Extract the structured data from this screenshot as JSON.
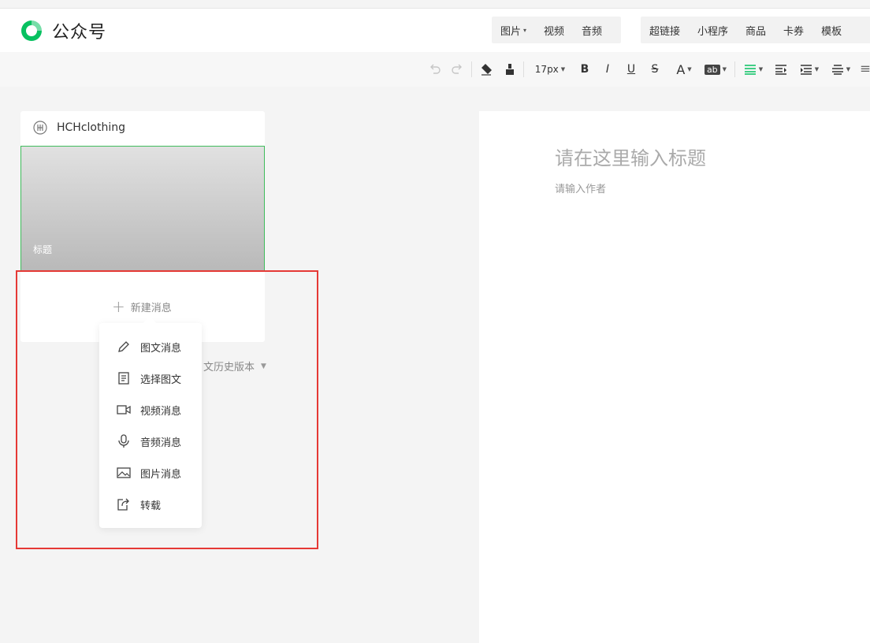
{
  "app": {
    "title": "公众号",
    "brand_color": "#07c160"
  },
  "header": {
    "media_group_1": [
      {
        "label": "图片",
        "has_caret": true
      },
      {
        "label": "视频"
      },
      {
        "label": "音频"
      }
    ],
    "media_group_2": [
      {
        "label": "超链接"
      },
      {
        "label": "小程序"
      },
      {
        "label": "商品"
      },
      {
        "label": "卡券"
      },
      {
        "label": "模板"
      }
    ]
  },
  "toolbar": {
    "font_size": "17px",
    "icons": [
      "undo-icon",
      "redo-icon",
      "format-clear-icon",
      "format-painter-icon",
      "bold-icon",
      "italic-icon",
      "underline-icon",
      "strikethrough-icon",
      "font-color-icon",
      "background-color-icon",
      "align-icon",
      "indent-icon",
      "paragraph-spacing-icon",
      "line-height-icon",
      "letter-spacing-icon"
    ],
    "bold": "B",
    "italic": "I",
    "underline": "U",
    "strike": "S",
    "font_color": "A",
    "bg_color": "ab",
    "accent_color": "#07c160"
  },
  "sidebar": {
    "account_name": "HCHclothing",
    "cover_title": "标题",
    "new_message": "新建消息",
    "history_fragment": "文历史版本"
  },
  "menu": {
    "items": [
      {
        "label": "图文消息",
        "icon": "pencil-icon"
      },
      {
        "label": "选择图文",
        "icon": "document-icon"
      },
      {
        "label": "视频消息",
        "icon": "video-icon"
      },
      {
        "label": "音频消息",
        "icon": "microphone-icon"
      },
      {
        "label": "图片消息",
        "icon": "image-icon"
      },
      {
        "label": "转载",
        "icon": "share-icon"
      }
    ]
  },
  "editor": {
    "title_placeholder": "请在这里输入标题",
    "author_placeholder": "请输入作者"
  },
  "highlight_color": "#e53935"
}
